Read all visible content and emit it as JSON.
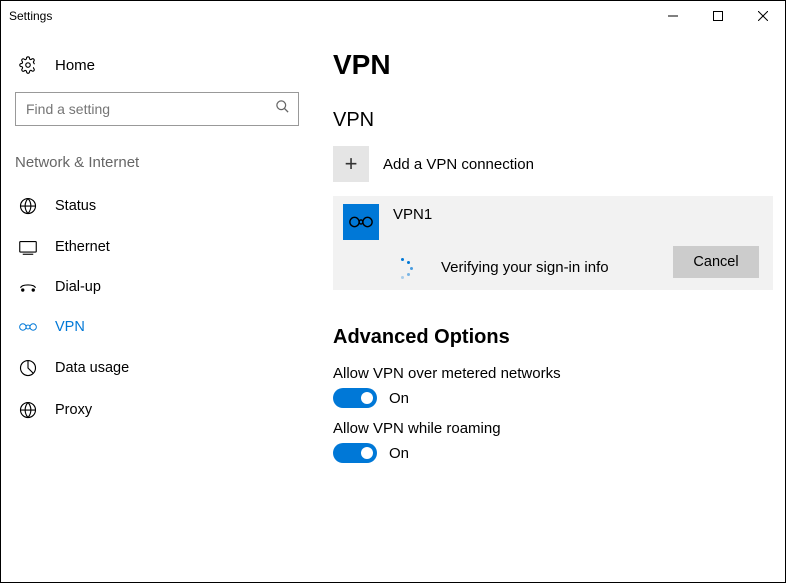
{
  "window": {
    "title": "Settings"
  },
  "sidebar": {
    "home": "Home",
    "search_placeholder": "Find a setting",
    "category": "Network & Internet",
    "items": [
      {
        "label": "Status"
      },
      {
        "label": "Ethernet"
      },
      {
        "label": "Dial-up"
      },
      {
        "label": "VPN"
      },
      {
        "label": "Data usage"
      },
      {
        "label": "Proxy"
      }
    ]
  },
  "main": {
    "page_title": "VPN",
    "section_title": "VPN",
    "add_label": "Add a VPN connection",
    "connection": {
      "name": "VPN1",
      "status": "Verifying your sign-in info",
      "cancel": "Cancel"
    },
    "adv_title": "Advanced Options",
    "opt1": {
      "label": "Allow VPN over metered networks",
      "state": "On"
    },
    "opt2": {
      "label": "Allow VPN while roaming",
      "state": "On"
    }
  }
}
